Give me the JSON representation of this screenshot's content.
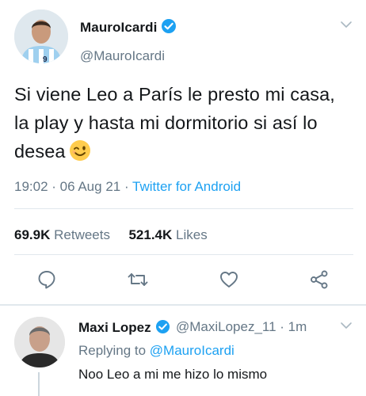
{
  "colors": {
    "accent": "#1da1f2",
    "secondary_text": "#657786",
    "primary_text": "#14171a",
    "divider": "#e1e8ed"
  },
  "tweet": {
    "author_name": "MauroIcardi",
    "author_handle": "@MauroIcardi",
    "verified_icon": "verified-badge-icon",
    "text": "Si viene Leo a París le presto mi casa, la play y hasta mi dormitorio si así lo desea",
    "emoji": "winking-face-emoji",
    "time": "19:02 · 06 Aug 21 · ",
    "client": "Twitter for Android",
    "retweets_count": "69.9K",
    "retweets_label": "Retweets",
    "likes_count": "521.4K",
    "likes_label": "Likes",
    "actions": [
      "reply-icon",
      "retweet-icon",
      "like-icon",
      "share-icon"
    ]
  },
  "reply": {
    "author_name": "Maxi Lopez",
    "author_handle": "@MaxiLopez_11 · 1m",
    "replying_prefix": "Replying to ",
    "replying_to": "@MauroIcardi",
    "text": "Noo Leo a mi me hizo lo mismo"
  }
}
